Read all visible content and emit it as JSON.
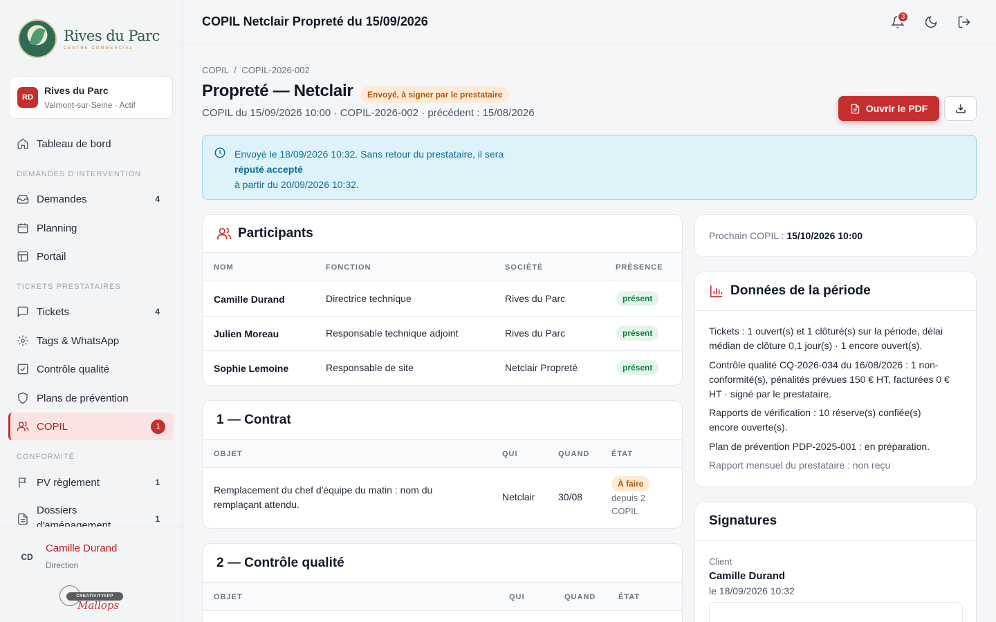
{
  "brand": {
    "name": "Rives du Parc",
    "sub": "CENTRE COMMERCIAL"
  },
  "site": {
    "initials": "RD",
    "name": "Rives du Parc",
    "location": "Valmont-sur-Seine · Actif"
  },
  "nav": {
    "dashboard": "Tableau de bord",
    "section1": "DEMANDES D'INTERVENTION",
    "demandes": {
      "label": "Demandes",
      "count": "4"
    },
    "planning": "Planning",
    "portail": "Portail",
    "section2": "TICKETS PRESTATAIRES",
    "tickets": {
      "label": "Tickets",
      "count": "4"
    },
    "tags": "Tags & WhatsApp",
    "qualite": "Contrôle qualité",
    "prevention": "Plans de prévention",
    "copil": {
      "label": "COPIL",
      "count": "1"
    },
    "section3": "CONFORMITÉ",
    "pv": {
      "label": "PV règlement",
      "count": "1"
    },
    "dossiers": {
      "label": "Dossiers d'aménagement",
      "count": "1"
    }
  },
  "user": {
    "initials": "CD",
    "name": "Camille Durand",
    "role": "Direction"
  },
  "footer_brand": {
    "pill": "CREATIVITYAPP",
    "script": "Mallops"
  },
  "header": {
    "title": "COPIL Netclair Propreté du 15/09/2026",
    "notifications": "3"
  },
  "page": {
    "crumb_root": "COPIL",
    "crumb_sep": "/",
    "crumb_current": "COPIL-2026-002",
    "title": "Propreté — Netclair",
    "status": "Envoyé, à signer par le prestataire",
    "subline": "COPIL du 15/09/2026 10:00 · COPIL-2026-002 · précédent : 15/08/2026",
    "open_pdf": "Ouvrir le PDF"
  },
  "alert": {
    "line1": "Envoyé le 18/09/2026 10:32. Sans retour du prestataire, il sera",
    "bold": "réputé accepté",
    "line2": "à partir du 20/09/2026 10:32."
  },
  "participants": {
    "title": "Participants",
    "headers": [
      "NOM",
      "FONCTION",
      "SOCIÉTÉ",
      "PRÉSENCE"
    ],
    "rows": [
      {
        "name": "Camille Durand",
        "role": "Directrice technique",
        "company": "Rives du Parc",
        "presence": "présent"
      },
      {
        "name": "Julien Moreau",
        "role": "Responsable technique adjoint",
        "company": "Rives du Parc",
        "presence": "présent"
      },
      {
        "name": "Sophie Lemoine",
        "role": "Responsable de site",
        "company": "Netclair Propreté",
        "presence": "présent"
      }
    ]
  },
  "contrat": {
    "title": "1 — Contrat",
    "headers": [
      "OBJET",
      "QUI",
      "QUAND",
      "ÉTAT"
    ],
    "rows": [
      {
        "object_1": "Remplacement du chef d'équipe du matin : nom du",
        "object_2": "remplaçant attendu.",
        "who": "Netclair",
        "when": "30/08",
        "state": "À faire",
        "state_note_1": "depuis 2",
        "state_note_2": "COPIL"
      }
    ]
  },
  "qualite": {
    "title": "2 — Contrôle qualité",
    "headers": [
      "OBJET",
      "QUI",
      "QUAND",
      "ÉTAT"
    ]
  },
  "next": {
    "label": "Prochain COPIL :",
    "value": "15/10/2026 10:00"
  },
  "periode": {
    "title": "Données de la période",
    "p1a": "Tickets : 1 ouvert(s) et 1 clôturé(s) sur la période, délai",
    "p1b": "médian de clôture 0,1 jour(s) · 1 encore ouvert(s).",
    "p2a": "Contrôle qualité CQ-2026-034 du 16/08/2026 : 1 non-",
    "p2b": "conformité(s), pénalités prévues 150 € HT, facturées 0 €",
    "p2c": "HT · signé par le prestataire.",
    "p3a": "Rapports de vérification : 10 réserve(s) confiée(s)",
    "p3b": "encore ouverte(s).",
    "p4": "Plan de prévention PDP-2025-001 : en préparation.",
    "p5": "Rapport mensuel du prestataire : non reçu"
  },
  "signatures": {
    "title": "Signatures",
    "client_label": "Client",
    "client_name": "Camille Durand",
    "client_date": "le 18/09/2026 10:32"
  }
}
